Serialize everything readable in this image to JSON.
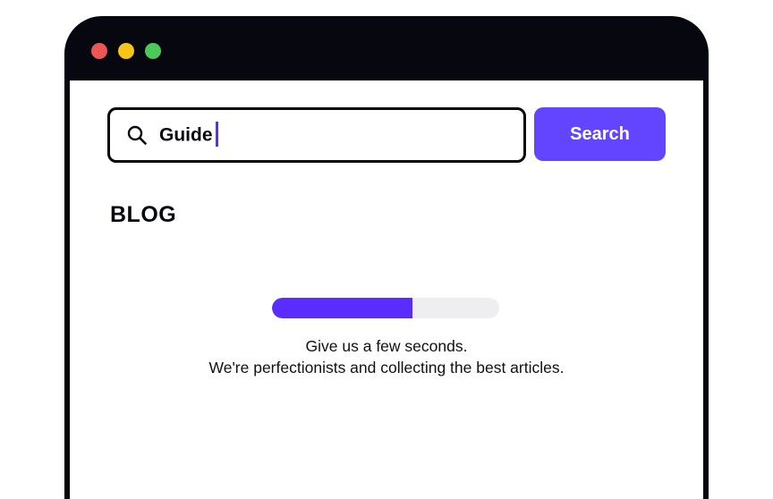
{
  "window": {
    "traffic_lights": [
      {
        "name": "close",
        "color": "#ee5555"
      },
      {
        "name": "minimize",
        "color": "#f5c518"
      },
      {
        "name": "zoom",
        "color": "#4cc75a"
      }
    ]
  },
  "search": {
    "icon": "search-icon",
    "value": "Guide",
    "button_label": "Search",
    "accent_color": "#6445ff"
  },
  "page": {
    "title": "BLOG"
  },
  "loading": {
    "progress_percent": 62,
    "bar_color": "#5b2cff",
    "track_color": "#eeeef0",
    "message_line1": "Give us a few seconds.",
    "message_line2": "We're perfectionists and collecting the best articles."
  }
}
